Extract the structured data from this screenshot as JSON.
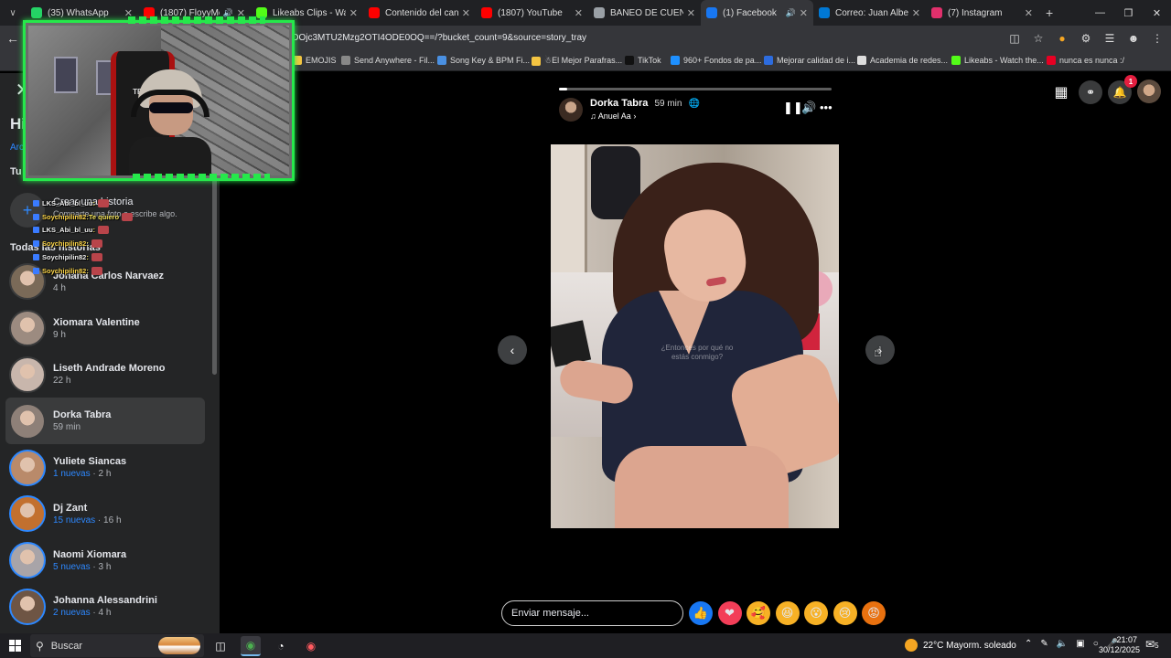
{
  "browser": {
    "tabs": [
      {
        "title": "(35) WhatsApp",
        "favicon_color": "#25d366",
        "active": false,
        "audio": false
      },
      {
        "title": "(1807) FloyyMeno",
        "favicon_color": "#ff0000",
        "active": false,
        "audio": true
      },
      {
        "title": "Likeabs Clips - Watch",
        "favicon_color": "#53fc18",
        "active": false,
        "audio": false
      },
      {
        "title": "Contenido del canal",
        "favicon_color": "#ff0000",
        "active": false,
        "audio": false
      },
      {
        "title": "(1807) YouTube",
        "favicon_color": "#ff0000",
        "active": false,
        "audio": false
      },
      {
        "title": "BANEO DE CUENTA",
        "favicon_color": "#9aa0a6",
        "active": false,
        "audio": false
      },
      {
        "title": "(1) Facebook",
        "favicon_color": "#1877f2",
        "active": true,
        "audio": true
      },
      {
        "title": "Correo: Juan Alberto",
        "favicon_color": "#0078d4",
        "active": false,
        "audio": false
      },
      {
        "title": "(7) Instagram",
        "favicon_color": "#e1306c",
        "active": false,
        "audio": false
      }
    ],
    "url": "NDOjc3MTU2Mzg2OTI4ODE0OQ==/?bucket_count=9&source=story_tray",
    "bookmarks": [
      {
        "label": "EMOJIS",
        "color": "#f5c542"
      },
      {
        "label": "Send Anywhere - Fil...",
        "color": "#888888"
      },
      {
        "label": "Song Key & BPM Fi...",
        "color": "#4a90e2"
      },
      {
        "label": "☃El Mejor Parafras...",
        "color": "#f5c542"
      },
      {
        "label": "TikTok",
        "color": "#111111"
      },
      {
        "label": "960+ Fondos de pa...",
        "color": "#1e90ff"
      },
      {
        "label": "Mejorar calidad de i...",
        "color": "#2d6cdf"
      },
      {
        "label": "Academia de redes...",
        "color": "#dddddd"
      },
      {
        "label": "Likeabs - Watch the...",
        "color": "#53fc18"
      },
      {
        "label": "nunca es nunca :/",
        "color": "#e60023"
      }
    ]
  },
  "sidebar": {
    "title": "Historias",
    "archive_link": "Archivo",
    "your_story_heading": "Tu historia",
    "create": {
      "title": "Crear una historia",
      "subtitle": "Comparte una foto o escribe algo."
    },
    "all_heading": "Todas las historias",
    "stories": [
      {
        "name": "Johana Carlos Narvaez",
        "new_count": "",
        "time": "4 h",
        "avatar": "#7a6a58",
        "unseen": false,
        "selected": false
      },
      {
        "name": "Xiomara Valentine",
        "new_count": "",
        "time": "9 h",
        "avatar": "#9c8b80",
        "unseen": false,
        "selected": false
      },
      {
        "name": "Liseth Andrade Moreno",
        "new_count": "",
        "time": "22 h",
        "avatar": "#c8b6ac",
        "unseen": false,
        "selected": false
      },
      {
        "name": "Dorka Tabra",
        "new_count": "",
        "time": "59 min",
        "avatar": "#8e8078",
        "unseen": false,
        "selected": true
      },
      {
        "name": "Yuliete Siancas",
        "new_count": "1 nuevas",
        "time": "2 h",
        "avatar": "#b98a6a",
        "unseen": true,
        "selected": false
      },
      {
        "name": "Dj Zant",
        "new_count": "15 nuevas",
        "time": "16 h",
        "avatar": "#c2702f",
        "unseen": true,
        "selected": false
      },
      {
        "name": "Naomi Xiomara",
        "new_count": "5 nuevas",
        "time": "3 h",
        "avatar": "#a8a4a8",
        "unseen": true,
        "selected": false
      },
      {
        "name": "Johanna Alessandrini",
        "new_count": "2 nuevas",
        "time": "4 h",
        "avatar": "#6e5544",
        "unseen": true,
        "selected": false
      }
    ]
  },
  "stream_overlay": {
    "chair_label": "TECH",
    "chat": [
      {
        "user": "LKS_Abi_bl_uu",
        "msg": ""
      },
      {
        "user": "Soychipilin82",
        "msg": "Te quiero"
      },
      {
        "user": "LKS_Abi_bl_uu",
        "msg": ""
      },
      {
        "user": "Soychipilin82",
        "msg": ""
      },
      {
        "user": "Soychipilin82",
        "msg": ""
      },
      {
        "user": "Soychipilin82",
        "msg": ""
      }
    ]
  },
  "viewer": {
    "owner_name": "Dorka Tabra",
    "owner_time": "59 min",
    "song": "♫ Anuel Aa",
    "progress": 0.03,
    "photo_caption": "¿Entonces por qué no estás conmigo?",
    "reply_placeholder": "Enviar mensaje...",
    "reactions": [
      {
        "name": "like",
        "glyph": "👍",
        "bg": "#1877f2"
      },
      {
        "name": "love",
        "glyph": "❤",
        "bg": "#f33e58"
      },
      {
        "name": "care",
        "glyph": "🥰",
        "bg": "#f7b125"
      },
      {
        "name": "haha",
        "glyph": "😆",
        "bg": "#f7b125"
      },
      {
        "name": "wow",
        "glyph": "😮",
        "bg": "#f7b125"
      },
      {
        "name": "sad",
        "glyph": "😢",
        "bg": "#f7b125"
      },
      {
        "name": "angry",
        "glyph": "😡",
        "bg": "#e9710f"
      }
    ],
    "notif_count": "1"
  },
  "taskbar": {
    "search_placeholder": "Buscar",
    "weather": "22°C  Mayorm. soleado",
    "time": "21:07",
    "date": "30/12/2025",
    "notif_count": "5"
  }
}
